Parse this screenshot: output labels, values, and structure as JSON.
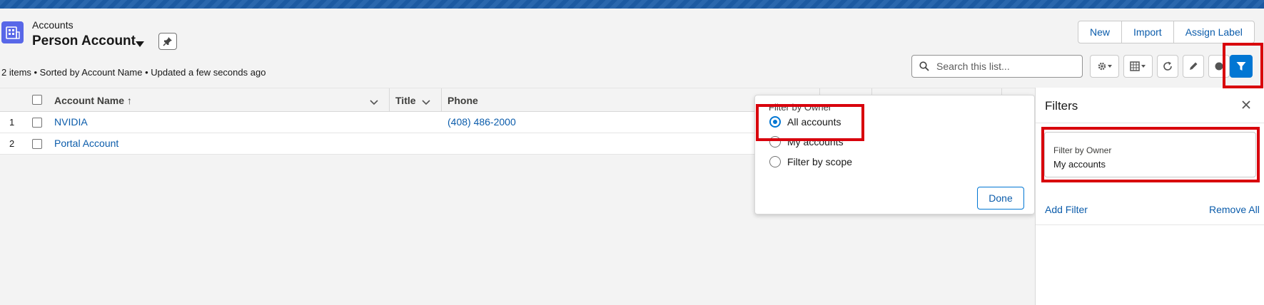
{
  "header": {
    "object_label": "Accounts",
    "list_view_name": "Person Account",
    "meta": "2 items • Sorted by Account Name • Updated a few seconds ago",
    "actions": [
      "New",
      "Import",
      "Assign Label"
    ]
  },
  "search": {
    "placeholder": "Search this list..."
  },
  "icons": {
    "object": "accounts-grid-icon",
    "caret": "chevron-down-icon",
    "pin": "pin-icon",
    "search": "search-icon",
    "settings": "gear-icon",
    "display": "table-view-icon",
    "refresh": "refresh-icon",
    "edit": "pencil-icon",
    "chart": "chart-icon",
    "filter": "filter-icon",
    "close": "close-icon"
  },
  "table": {
    "columns": [
      "Account Name ↑",
      "Title",
      "Phone"
    ],
    "rows": [
      {
        "num": "1",
        "account_name": "NVIDIA",
        "title": "",
        "phone": "(408) 486-2000"
      },
      {
        "num": "2",
        "account_name": "Portal Account",
        "title": "",
        "phone": ""
      }
    ]
  },
  "owner_popover": {
    "legend": "Filter by Owner",
    "options": [
      {
        "label": "All accounts",
        "checked": true
      },
      {
        "label": "My accounts",
        "checked": false
      },
      {
        "label": "Filter by scope",
        "checked": false
      }
    ],
    "done_label": "Done"
  },
  "filters_panel": {
    "title": "Filters",
    "filter_label": "Filter by Owner",
    "filter_value": "My accounts",
    "add_filter": "Add Filter",
    "remove_all": "Remove All"
  },
  "colors": {
    "brand_blue": "#0176d3",
    "link_blue": "#0b5cab",
    "object_icon": "#5867e8",
    "highlight_red": "#d8000c"
  }
}
